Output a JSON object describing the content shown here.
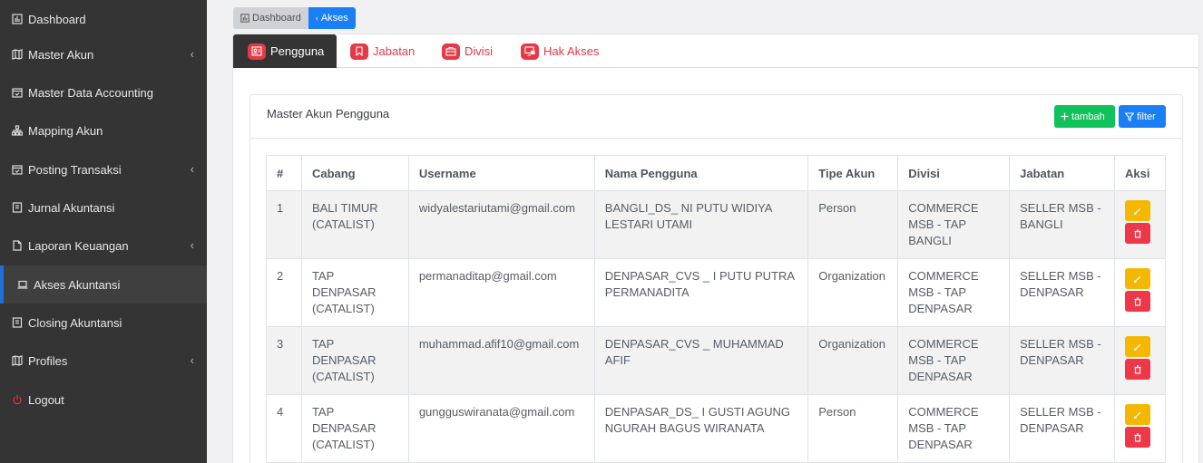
{
  "sidebar": {
    "items": [
      {
        "label": "Dashboard",
        "icon": "bar-chart-icon",
        "has_submenu": false
      },
      {
        "label": "Master Akun",
        "icon": "map-icon",
        "has_submenu": true
      },
      {
        "label": "Master Data Accounting",
        "icon": "calendar-check-icon",
        "has_submenu": false
      },
      {
        "label": "Mapping Akun",
        "icon": "sitemap-icon",
        "has_submenu": false
      },
      {
        "label": "Posting Transaksi",
        "icon": "calendar-check-icon",
        "has_submenu": true
      },
      {
        "label": "Jurnal Akuntansi",
        "icon": "journal-icon",
        "has_submenu": false
      },
      {
        "label": "Laporan Keuangan",
        "icon": "file-icon",
        "has_submenu": true
      },
      {
        "label": "Akses Akuntansi",
        "icon": "laptop-icon",
        "has_submenu": false,
        "active": true
      },
      {
        "label": "Closing Akuntansi",
        "icon": "journal-icon",
        "has_submenu": false
      },
      {
        "label": "Profiles",
        "icon": "map-icon",
        "has_submenu": true
      },
      {
        "label": "Logout",
        "icon": "power-icon",
        "has_submenu": false
      }
    ]
  },
  "breadcrumb": {
    "items": [
      {
        "label": "Dashboard",
        "icon": "bar-chart-icon"
      },
      {
        "label": "Akses",
        "icon": "chevron-icon"
      }
    ]
  },
  "tabs": [
    {
      "label": "Pengguna",
      "icon": "user-card-icon",
      "active": true
    },
    {
      "label": "Jabatan",
      "icon": "bookmark-icon",
      "active": false
    },
    {
      "label": "Divisi",
      "icon": "briefcase-icon",
      "active": false
    },
    {
      "label": "Hak Akses",
      "icon": "monitor-lock-icon",
      "active": false
    }
  ],
  "panel": {
    "title": "Master Akun Pengguna",
    "add_label": "tambah",
    "filter_label": "filter"
  },
  "table": {
    "headers": [
      "#",
      "Cabang",
      "Username",
      "Nama Pengguna",
      "Tipe Akun",
      "Divisi",
      "Jabatan",
      "Aksi"
    ],
    "rows": [
      [
        "1",
        "BALI TIMUR (CATALIST)",
        "widyalestariutami@gmail.com",
        "BANGLI_DS_ NI PUTU WIDIYA LESTARI UTAMI",
        "Person",
        "COMMERCE MSB - TAP BANGLI",
        "SELLER MSB - BANGLI"
      ],
      [
        "2",
        "TAP DENPASAR (CATALIST)",
        "permanaditap@gmail.com",
        "DENPASAR_CVS _ I PUTU PUTRA PERMANADITA",
        "Organization",
        "COMMERCE MSB - TAP DENPASAR",
        "SELLER MSB - DENPASAR"
      ],
      [
        "3",
        "TAP DENPASAR (CATALIST)",
        "muhammad.afif10@gmail.com",
        "DENPASAR_CVS _ MUHAMMAD AFIF",
        "Organization",
        "COMMERCE MSB - TAP DENPASAR",
        "SELLER MSB - DENPASAR"
      ],
      [
        "4",
        "TAP DENPASAR (CATALIST)",
        "gungguswiranata@gmail.com",
        "DENPASAR_DS_ I GUSTI AGUNG NGURAH BAGUS WIRANATA",
        "Person",
        "COMMERCE MSB - TAP DENPASAR",
        "SELLER MSB - DENPASAR"
      ]
    ]
  },
  "colors": {
    "sidebar_bg": "#343434",
    "accent_blue": "#1a7ff5",
    "tab_red": "#e53945",
    "add_green": "#11c15b",
    "edit_yellow": "#f5b800",
    "delete_red": "#ee3849"
  }
}
